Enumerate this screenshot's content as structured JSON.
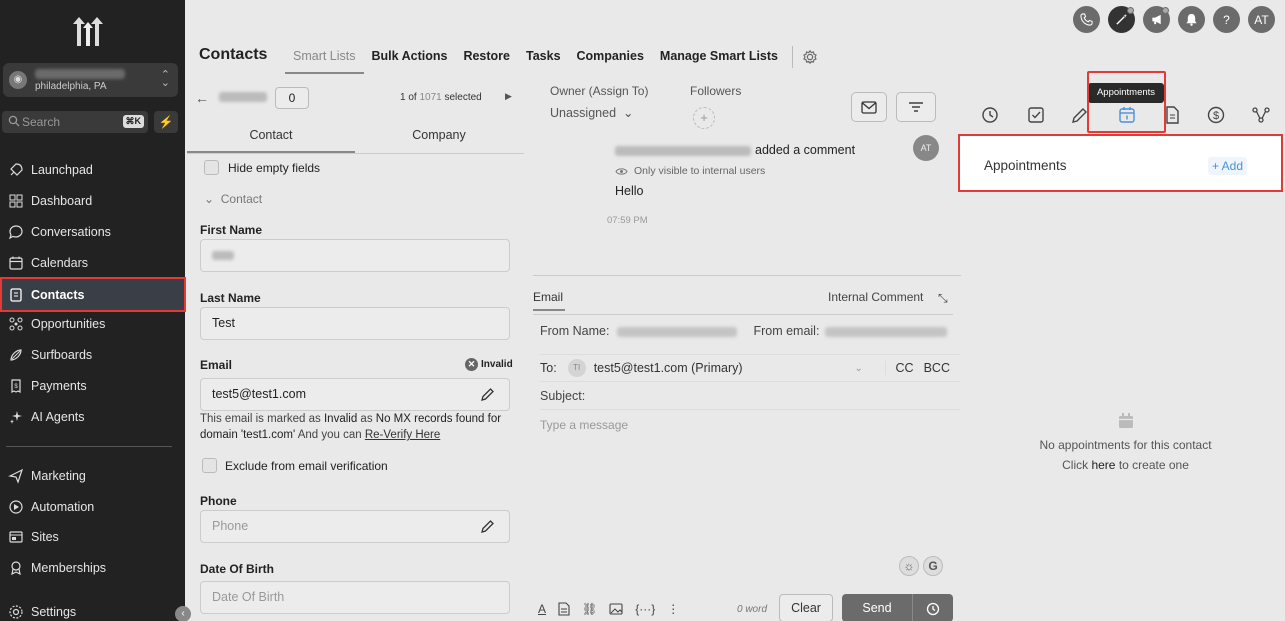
{
  "sidebar": {
    "location_city": "philadelphia, PA",
    "search_placeholder": "Search",
    "search_shortcut": "⌘K",
    "items": [
      {
        "label": "Launchpad"
      },
      {
        "label": "Dashboard"
      },
      {
        "label": "Conversations"
      },
      {
        "label": "Calendars"
      },
      {
        "label": "Contacts",
        "active": true
      },
      {
        "label": "Opportunities"
      },
      {
        "label": "Surfboards"
      },
      {
        "label": "Payments"
      },
      {
        "label": "AI Agents"
      },
      {
        "label": "Marketing"
      },
      {
        "label": "Automation"
      },
      {
        "label": "Sites"
      },
      {
        "label": "Memberships"
      },
      {
        "label": "Settings"
      }
    ]
  },
  "header": {
    "title": "Contacts",
    "nav": [
      "Smart Lists",
      "Bulk Actions",
      "Restore",
      "Tasks",
      "Companies",
      "Manage Smart Lists"
    ],
    "user_initials": "AT",
    "help_icon_label": "?"
  },
  "contact_panel": {
    "count": "0",
    "pager_current": "1 of",
    "pager_total": "1071",
    "pager_selected": "selected",
    "tabs": [
      "Contact",
      "Company"
    ],
    "hide_empty_label": "Hide empty fields",
    "section_label": "Contact",
    "first_name_label": "First Name",
    "last_name_label": "Last Name",
    "last_name_value": "Test",
    "email_label": "Email",
    "email_value": "test5@test1.com",
    "invalid_label": "Invalid",
    "email_note_pre": "This email is marked as ",
    "email_note_invalid": "Invalid",
    "email_note_mid": " as ",
    "email_note_reason": "No MX records found for domain 'test1.com'",
    "email_note_post": " And you can ",
    "email_note_link": "Re-Verify Here",
    "exclude_label": "Exclude from email verification",
    "phone_label": "Phone",
    "phone_placeholder": "Phone",
    "dob_label": "Date Of Birth",
    "dob_placeholder": "Date Of Birth"
  },
  "activity": {
    "owner_label": "Owner (Assign To)",
    "owner_value": "Unassigned",
    "followers_label": "Followers",
    "comment_action": "added a comment",
    "visibility_note": "Only visible to internal users",
    "comment_text": "Hello",
    "comment_time": "07:59 PM",
    "avatar_initials": "AT"
  },
  "composer": {
    "tab_email": "Email",
    "tab_internal": "Internal Comment",
    "from_name_label": "From Name:",
    "from_email_label": "From email:",
    "to_label": "To:",
    "to_avatar": "TI",
    "to_value": "test5@test1.com (Primary)",
    "cc": "CC",
    "bcc": "BCC",
    "subject_label": "Subject:",
    "message_placeholder": "Type a message",
    "word_count": "0 word",
    "clear": "Clear",
    "send": "Send"
  },
  "right_panel": {
    "tooltip": "Appointments",
    "title": "Appointments",
    "add": "+ Add",
    "empty_line1": "No appointments for this contact",
    "empty_click": "Click ",
    "empty_here": "here",
    "empty_rest": " to create one"
  }
}
